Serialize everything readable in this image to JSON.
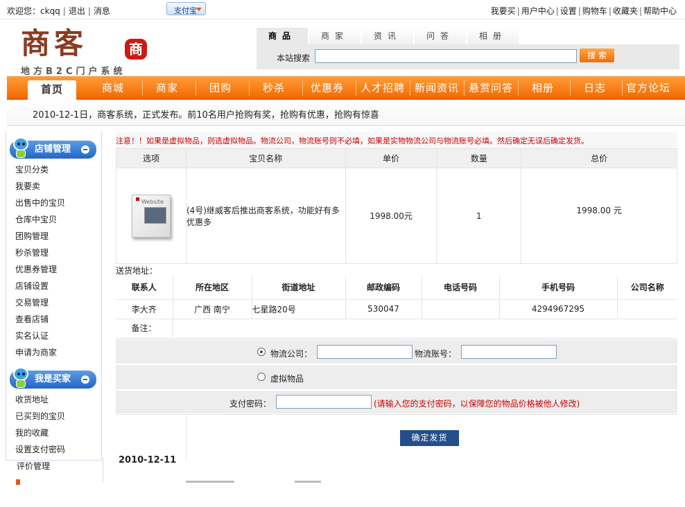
{
  "topbar": {
    "welcome": "欢迎您：",
    "username": "ckqq",
    "logout": "退出",
    "messages": "消息",
    "alipay": "支付宝",
    "links": [
      "我要买",
      "用户中心",
      "设置",
      "购物车",
      "收藏夹",
      "帮助中心"
    ]
  },
  "logo": {
    "title": "商客",
    "stamp": "商",
    "subtitle": "地方B2C门户系统"
  },
  "search": {
    "tabs": [
      "商品",
      "商家",
      "资讯",
      "问答",
      "相册"
    ],
    "active_tab": "商品",
    "label": "本站搜索",
    "value": "",
    "button": "搜索"
  },
  "nav": {
    "items": [
      "首页",
      "商城",
      "商家",
      "团购",
      "秒杀",
      "优惠券",
      "人才招聘",
      "新闻资讯",
      "悬赏问答",
      "相册",
      "日志",
      "官方论坛"
    ],
    "active": "首页"
  },
  "notice": "2010-12-1日，商客系统，正式发布。前10名用户抢购有奖，抢购有优惠，抢购有惊喜",
  "sidebar": {
    "shop_title": "店铺管理",
    "shop_items": [
      "宝贝分类",
      "我要卖",
      "出售中的宝贝",
      "仓库中宝贝",
      "团购管理",
      "秒杀管理",
      "优惠券管理",
      "店铺设置",
      "交易管理",
      "查看店铺",
      "实名认证",
      "申请为商家"
    ],
    "buyer_title": "我是买家",
    "buyer_items": [
      "收货地址",
      "已买到的宝贝",
      "我的收藏",
      "设置支付密码"
    ],
    "extra_item": "评价管理"
  },
  "order": {
    "warning": "注意！！如果是虚拟物品，则选虚拟物品。物流公司，物流账号则不必填，如果是实物物流公司与物流账号必填。然后确定无误后确定发货。",
    "headers": [
      "选项",
      "宝贝名称",
      "单价",
      "数量",
      "总价"
    ],
    "item": {
      "image_text": "Website",
      "name": "(4号)继威客后推出商客系统，功能好有多优惠多",
      "price": "1998.00元",
      "qty": "1",
      "total": "1998.00 元"
    }
  },
  "address": {
    "label": "送货地址：",
    "headers": [
      "联系人",
      "所在地区",
      "街道地址",
      "邮政编码",
      "电话号码",
      "手机号码",
      "公司名称"
    ],
    "row": [
      "李大齐",
      "广西 南宁",
      "七星路20号",
      "530047",
      "",
      "4294967295",
      ""
    ],
    "remark_label": "备注：",
    "remark_value": ""
  },
  "shipping": {
    "logistics_label": "物流公司：",
    "logistics_value": "",
    "account_label": "物流账号：",
    "account_value": "",
    "virtual_label": "虚拟物品",
    "paypwd_label": "支付密码：",
    "paypwd_value": "",
    "paypwd_hint": "(请输入您的支付密码，以保障您的物品价格被他人修改)",
    "submit": "确定发货"
  },
  "footer_date": "2010-12-11"
}
